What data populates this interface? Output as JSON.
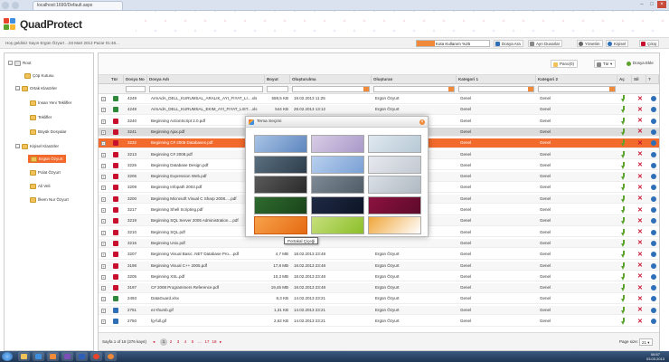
{
  "browser": {
    "tab_title": "localhost:1690/Default.aspx"
  },
  "app": {
    "brand": "QuadProtect"
  },
  "welcome_bar": {
    "welcome_text": "Hoş geldiniz Sayın Ergün Özyurt  ...03 Mart 2013 Pazar 01:48...",
    "quota_label": "Kota Kullanım %25",
    "quota_fraction": 0.25,
    "buttons": [
      "Dosya Ara",
      "Ayrı Duvarlar",
      "Yönetim",
      "Kişisel",
      "Çıkış"
    ]
  },
  "sidebar": {
    "root": "Root",
    "trash": "Çöp Kutusu",
    "shared": "Ortak Klasörler",
    "shared_items": [
      "İnsan Yeni Teklifler",
      "Teklifler",
      "Büyük Dosyalar"
    ],
    "personal": "Kişisel Klasörler",
    "personal_items": [
      "Ergün Özyurt",
      "Polat Özyurt",
      "Ali Veli",
      "İlkem Nur Özyurt"
    ]
  },
  "toolbar": {
    "panel_label": "Pano(0)",
    "view_label": "Tür",
    "add_label": "Dosya Ekle"
  },
  "grid": {
    "headers": [
      "Tür",
      "Dosya No",
      "Dosya Adı",
      "Boyut",
      "Oluşturulma",
      "Oluşturan",
      "Kategori 1",
      "Kategori 2",
      "Aç",
      "Sil",
      "?"
    ],
    "rows": [
      {
        "no": "4249",
        "name": "ArmAdA_DELL_KURUMSAL_ARALIK_AYI_FIYAT_LI....xls",
        "size": "559,5 KB",
        "date": "19.02.2013 11:25",
        "owner": "Ergün Özyurt",
        "cat1": "Genel",
        "cat2": "Genel",
        "type": "xls"
      },
      {
        "no": "4248",
        "name": "ArmAdA_DELL_KURUMSAL_EKIM_AYI_FIYAT_LIST....xls",
        "size": "544 KB",
        "date": "28.02.2013 13:12",
        "owner": "Ergün Özyurt",
        "cat1": "Genel",
        "cat2": "Genel",
        "type": "xls"
      },
      {
        "no": "3240",
        "name": "Beginning ActionScript 2.0.pdf",
        "size": "",
        "date": "",
        "owner": "",
        "cat1": "Genel",
        "cat2": "Genel",
        "type": "pdf"
      },
      {
        "no": "3241",
        "name": "Beginning Ajax.pdf",
        "size": "",
        "date": "",
        "owner": "",
        "cat1": "Genel",
        "cat2": "Genel",
        "type": "pdf"
      },
      {
        "no": "3232",
        "name": "Beginning C# 2005 Databases.pdf",
        "size": "",
        "date": "",
        "owner": "",
        "cat1": "Genel",
        "cat2": "Genel",
        "type": "pdf"
      },
      {
        "no": "3213",
        "name": "Beginning C# 2008.pdf",
        "size": "",
        "date": "",
        "owner": "",
        "cat1": "Genel",
        "cat2": "Genel",
        "type": "pdf"
      },
      {
        "no": "3226",
        "name": "Beginning Database Design.pdf",
        "size": "",
        "date": "",
        "owner": "",
        "cat1": "Genel",
        "cat2": "Genel",
        "type": "pdf"
      },
      {
        "no": "3206",
        "name": "Beginning Expression Web.pdf",
        "size": "",
        "date": "",
        "owner": "",
        "cat1": "Genel",
        "cat2": "Genel",
        "type": "pdf"
      },
      {
        "no": "3209",
        "name": "Beginning Infopath 2003.pdf",
        "size": "",
        "date": "",
        "owner": "",
        "cat1": "Genel",
        "cat2": "Genel",
        "type": "pdf"
      },
      {
        "no": "3200",
        "name": "Beginning Microsoft Visual C Sharp 2008.....pdf",
        "size": "",
        "date": "",
        "owner": "",
        "cat1": "Genel",
        "cat2": "Genel",
        "type": "pdf"
      },
      {
        "no": "3217",
        "name": "Beginning Shell Scripting.pdf",
        "size": "",
        "date": "",
        "owner": "",
        "cat1": "Genel",
        "cat2": "Genel",
        "type": "pdf"
      },
      {
        "no": "3219",
        "name": "Beginning SQL Server 2005 Administration....pdf",
        "size": "",
        "date": "",
        "owner": "",
        "cat1": "Genel",
        "cat2": "Genel",
        "type": "pdf"
      },
      {
        "no": "3210",
        "name": "Beginning SQL.pdf",
        "size": "",
        "date": "",
        "owner": "",
        "cat1": "Genel",
        "cat2": "Genel",
        "type": "pdf"
      },
      {
        "no": "3216",
        "name": "Beginning Unix.pdf",
        "size": "",
        "date": "",
        "owner": "",
        "cat1": "Genel",
        "cat2": "Genel",
        "type": "pdf"
      },
      {
        "no": "3207",
        "name": "Beginning Visual Basic .NET Database Pro....pdf",
        "size": "4,7 MB",
        "date": "18.02.2013 23:48",
        "owner": "Ergün Özyurt",
        "cat1": "Genel",
        "cat2": "Genel",
        "type": "pdf"
      },
      {
        "no": "3198",
        "name": "Beginning Visual C++ 2005.pdf",
        "size": "17,8 MB",
        "date": "18.02.2013 23:48",
        "owner": "Ergün Özyurt",
        "cat1": "Genel",
        "cat2": "Genel",
        "type": "pdf"
      },
      {
        "no": "3205",
        "name": "Beginning XSL.pdf",
        "size": "10,3 MB",
        "date": "18.02.2013 23:48",
        "owner": "Ergün Özyurt",
        "cat1": "Genel",
        "cat2": "Genel",
        "type": "pdf"
      },
      {
        "no": "3197",
        "name": "C# 2008 Programmers Reference.pdf",
        "size": "19,46 MB",
        "date": "18.02.2013 23:48",
        "owner": "Ergün Özyurt",
        "cat1": "Genel",
        "cat2": "Genel",
        "type": "pdf"
      },
      {
        "no": "2493",
        "name": "DataGuard.xlsx",
        "size": "8,3 KB",
        "date": "14.02.2013 23:21",
        "owner": "Ergün Özyurt",
        "cat1": "Genel",
        "cat2": "Genel",
        "type": "xls"
      },
      {
        "no": "2751",
        "name": "ez-thumb.gif",
        "size": "1,31 KB",
        "date": "14.02.2013 23:21",
        "owner": "Ergün Özyurt",
        "cat1": "Genel",
        "cat2": "Genel",
        "type": "gif"
      },
      {
        "no": "2750",
        "name": "fg-full.gif",
        "size": "2,62 KB",
        "date": "14.02.2013 23:21",
        "owner": "Ergün Özyurt",
        "cat1": "Genel",
        "cat2": "Genel",
        "type": "gif"
      }
    ]
  },
  "pager": {
    "summary": "Sayfa 1 of 18 (376 kayıt)",
    "pages": [
      "1",
      "2",
      "3",
      "4",
      "5",
      "...",
      "17",
      "18"
    ],
    "current": "1",
    "page_size_label": "Page size:",
    "page_size": "21"
  },
  "modal": {
    "title": "Tema Seçimi",
    "themes": [
      {
        "name": "tema-1",
        "c1": "#a9c4e6",
        "c2": "#5d86bd"
      },
      {
        "name": "tema-2",
        "c1": "#d8cde6",
        "c2": "#a899c8"
      },
      {
        "name": "tema-3",
        "c1": "#dfe8ef",
        "c2": "#b7c9d6"
      },
      {
        "name": "tema-4",
        "c1": "#5a6f7f",
        "c2": "#2e3d4a"
      },
      {
        "name": "tema-5",
        "c1": "#b8d0ef",
        "c2": "#7aa0d4"
      },
      {
        "name": "tema-6",
        "c1": "#e6e9ee",
        "c2": "#c3c9d2"
      },
      {
        "name": "tema-7",
        "c1": "#5a5a5a",
        "c2": "#2a2a2a"
      },
      {
        "name": "tema-8",
        "c1": "#7d8a95",
        "c2": "#505c66"
      },
      {
        "name": "tema-9",
        "c1": "#d9dfe5",
        "c2": "#b0b9c2"
      },
      {
        "name": "tema-10",
        "c1": "#2f6b2f",
        "c2": "#1a441a"
      },
      {
        "name": "tema-11",
        "c1": "#1f2a44",
        "c2": "#0d1426"
      },
      {
        "name": "tema-12",
        "c1": "#8c1240",
        "c2": "#5e0a2a"
      },
      {
        "name": "portakal-cicegi",
        "c1": "#f7a24a",
        "c2": "#e56a12"
      },
      {
        "name": "tema-14",
        "c1": "#c6df7b",
        "c2": "#8cbf2a"
      },
      {
        "name": "tema-15",
        "c1": "#f0a63a",
        "c2": "#ffffff"
      }
    ],
    "tooltip": "Portakal Çiçeği"
  },
  "taskbar": {
    "time": "06:57",
    "date": "03.03.2013"
  },
  "colors": {
    "accent": "#f26a2c",
    "brand_red": "#c8102e",
    "download_green": "#5ca32c",
    "info_blue": "#2e6fb8"
  }
}
